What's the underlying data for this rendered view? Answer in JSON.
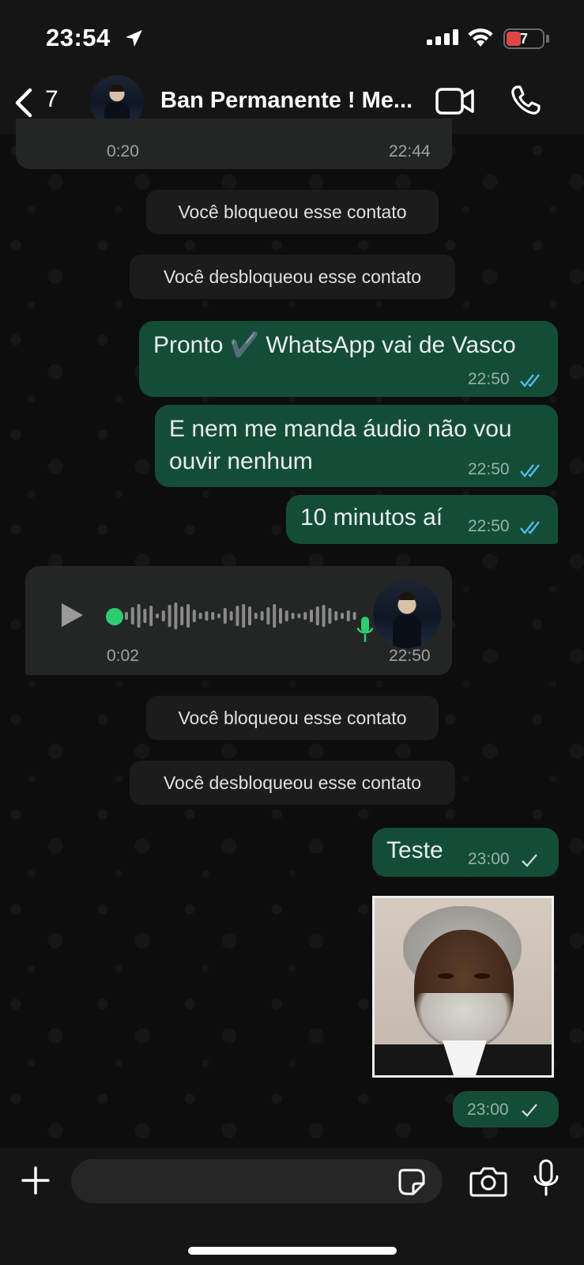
{
  "status_bar": {
    "time": "23:54",
    "battery": "7",
    "battery_color": "#e14646"
  },
  "header": {
    "back_count": "7",
    "contact_name": "Ban Permanente ! Me...",
    "icons": [
      "chevron-left-icon",
      "video-call-icon",
      "phone-call-icon"
    ]
  },
  "messages": {
    "prev_audio": {
      "duration": "0:20",
      "time": "22:44"
    },
    "system1": "Você bloqueou esse contato",
    "system2": "Você desbloqueou esse contato",
    "out1": {
      "text": "Pronto ✔️ WhatsApp vai de Vasco",
      "time": "22:50",
      "status": "read"
    },
    "out2": {
      "line1": "E nem me manda áudio  não vou",
      "line2": "ouvir nenhum",
      "time": "22:50",
      "status": "read"
    },
    "out3": {
      "text": "10 minutos aí",
      "time": "22:50",
      "status": "read"
    },
    "voice": {
      "duration": "0:02",
      "time": "22:50",
      "progress": 0
    },
    "system3": "Você bloqueou esse contato",
    "system4": "Você desbloqueou esse contato",
    "out4": {
      "text": "Teste",
      "time": "23:00",
      "status": "sent"
    },
    "out5": {
      "time": "23:00",
      "status": "sent"
    }
  },
  "colors": {
    "outgoing_bubble": "#144d37",
    "incoming_bubble": "#242626",
    "read_tick": "#53bdeb",
    "accent_green": "#2ecc71"
  },
  "composer": {
    "placeholder": ""
  }
}
